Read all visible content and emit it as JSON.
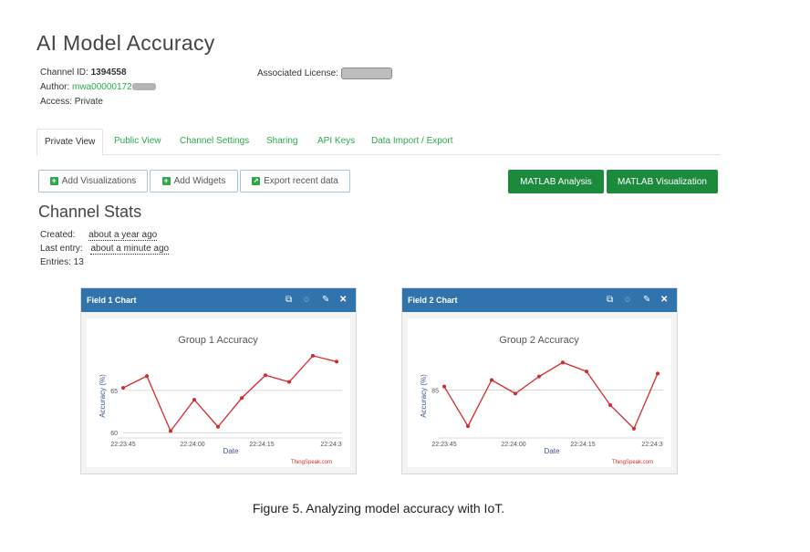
{
  "page": {
    "title": "AI Model Accuracy",
    "channel_id_label": "Channel ID:",
    "channel_id": "1394558",
    "author_label": "Author:",
    "author": "mwa00000172",
    "access": "Access: Private",
    "license_label": "Associated License:"
  },
  "tabs": [
    {
      "label": "Private View",
      "active": true
    },
    {
      "label": "Public View"
    },
    {
      "label": "Channel Settings"
    },
    {
      "label": "Sharing"
    },
    {
      "label": "API Keys"
    },
    {
      "label": "Data Import / Export"
    }
  ],
  "buttons": {
    "add_visualizations": "Add Visualizations",
    "add_widgets": "Add Widgets",
    "export_recent_data": "Export recent data",
    "matlab_analysis": "MATLAB Analysis",
    "matlab_visualization": "MATLAB Visualization"
  },
  "stats": {
    "heading": "Channel Stats",
    "created_label": "Created:",
    "created_value": "about a year ago",
    "last_entry_label": "Last entry:",
    "last_entry_value": "about a minute ago",
    "entries": "Entries: 13"
  },
  "icons": [
    "external-link-icon",
    "comment-icon",
    "pencil-icon",
    "close-icon"
  ],
  "colors": {
    "accent_green": "#1b8a3d",
    "link_green": "#2aa84a",
    "panel_blue": "#3173ad",
    "line_red": "#d62728"
  },
  "chart_data": [
    {
      "type": "line",
      "panel_title": "Field 1 Chart",
      "title": "Group 1 Accuracy",
      "xlabel": "Date",
      "ylabel": "Accuracy (%)",
      "credit": "ThingSpeak.com",
      "x_ticks": [
        "22:23:45",
        "22:24:00",
        "22:24:15",
        "22:24:3"
      ],
      "y_ticks": [
        60,
        65
      ],
      "ylim": [
        59.7,
        69.2
      ],
      "x_seconds": [
        -3,
        0,
        5,
        10,
        15,
        20,
        25,
        30,
        35
      ],
      "y": [
        65.3,
        66.7,
        60.2,
        63.9,
        60.7,
        64.1,
        66.8,
        66.0,
        69.1,
        68.4
      ]
    },
    {
      "type": "line",
      "panel_title": "Field 2 Chart",
      "title": "Group 2 Accuracy",
      "xlabel": "Date",
      "ylabel": "Accuracy (%)",
      "credit": "ThingSpeak.com",
      "x_ticks": [
        "22:23:45",
        "22:24:00",
        "22:24:15",
        "22:24:3"
      ],
      "y_ticks": [
        85
      ],
      "ylim": [
        76,
        92
      ],
      "y": [
        85.7,
        77.8,
        87.0,
        84.3,
        87.7,
        90.5,
        88.7,
        82.0,
        77.3,
        88.3
      ]
    }
  ],
  "caption": "Figure 5. Analyzing model accuracy with IoT."
}
